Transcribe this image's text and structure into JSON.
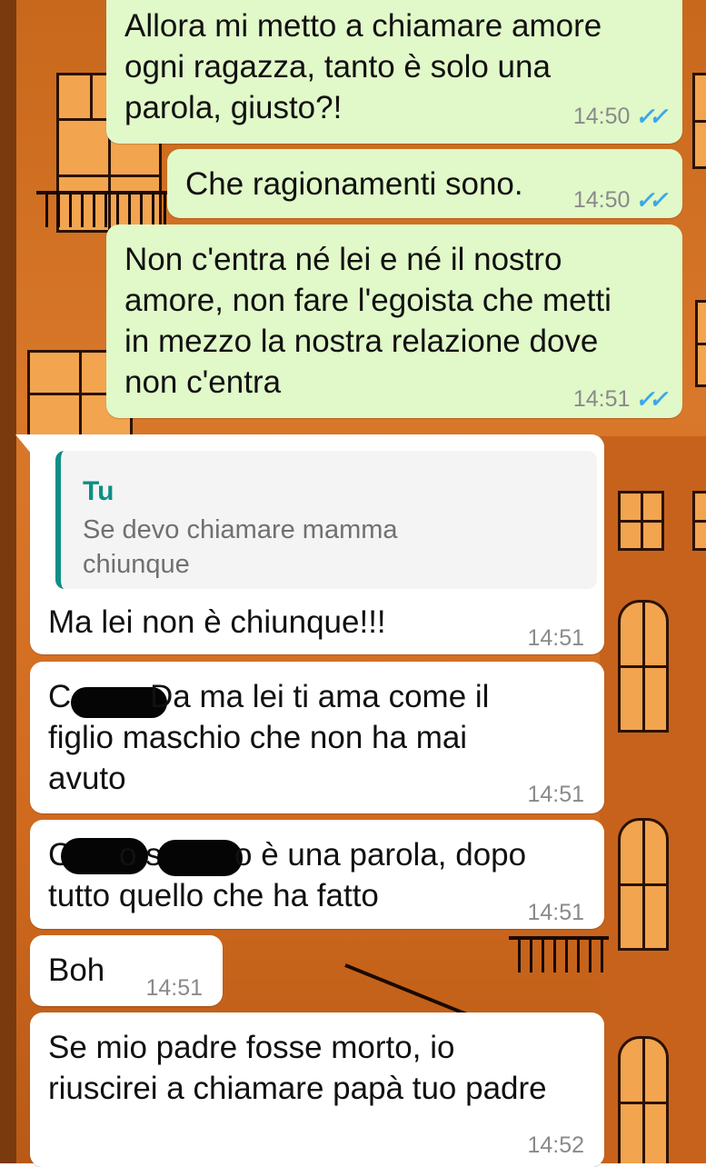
{
  "messages": [
    {
      "text": "Allora mi metto a chiamare amore\nogni ragazza, tanto è solo una\nparola, giusto?!",
      "time": "14:50",
      "ticks": "✓✓"
    },
    {
      "text": "Che ragionamenti sono.",
      "time": "14:50",
      "ticks": "✓✓"
    },
    {
      "text": "Non c'entra né lei e né il nostro\namore, non fare l'egoista che metti\nin mezzo la nostra relazione dove\nnon c'entra",
      "time": "14:51",
      "ticks": "✓✓"
    },
    {
      "quote_author": "Tu",
      "quote_text": "Se devo chiamare mamma\nchiunque",
      "text": "Ma lei non è chiunque!!!",
      "time": "14:51"
    },
    {
      "text_a": "C",
      "text_b": "Da ma lei ti ama come il\nfiglio maschio che non ha mai\navuto",
      "time": "14:51"
    },
    {
      "text_a": "C",
      "text_b": "o s",
      "text_c": "o è una parola, dopo",
      "text_d": "tutto quello che ha fatto",
      "time": "14:51"
    },
    {
      "text": "Boh",
      "time": "14:51"
    },
    {
      "text": "Se mio padre fosse morto, io\nriuscirei a chiamare papà tuo padre",
      "time": "14:52"
    }
  ],
  "colors": {
    "outgoing": "#e1f8c9",
    "incoming": "#ffffff",
    "reply_bar": "#0f8f84",
    "ticks": "#3aa8e8"
  }
}
